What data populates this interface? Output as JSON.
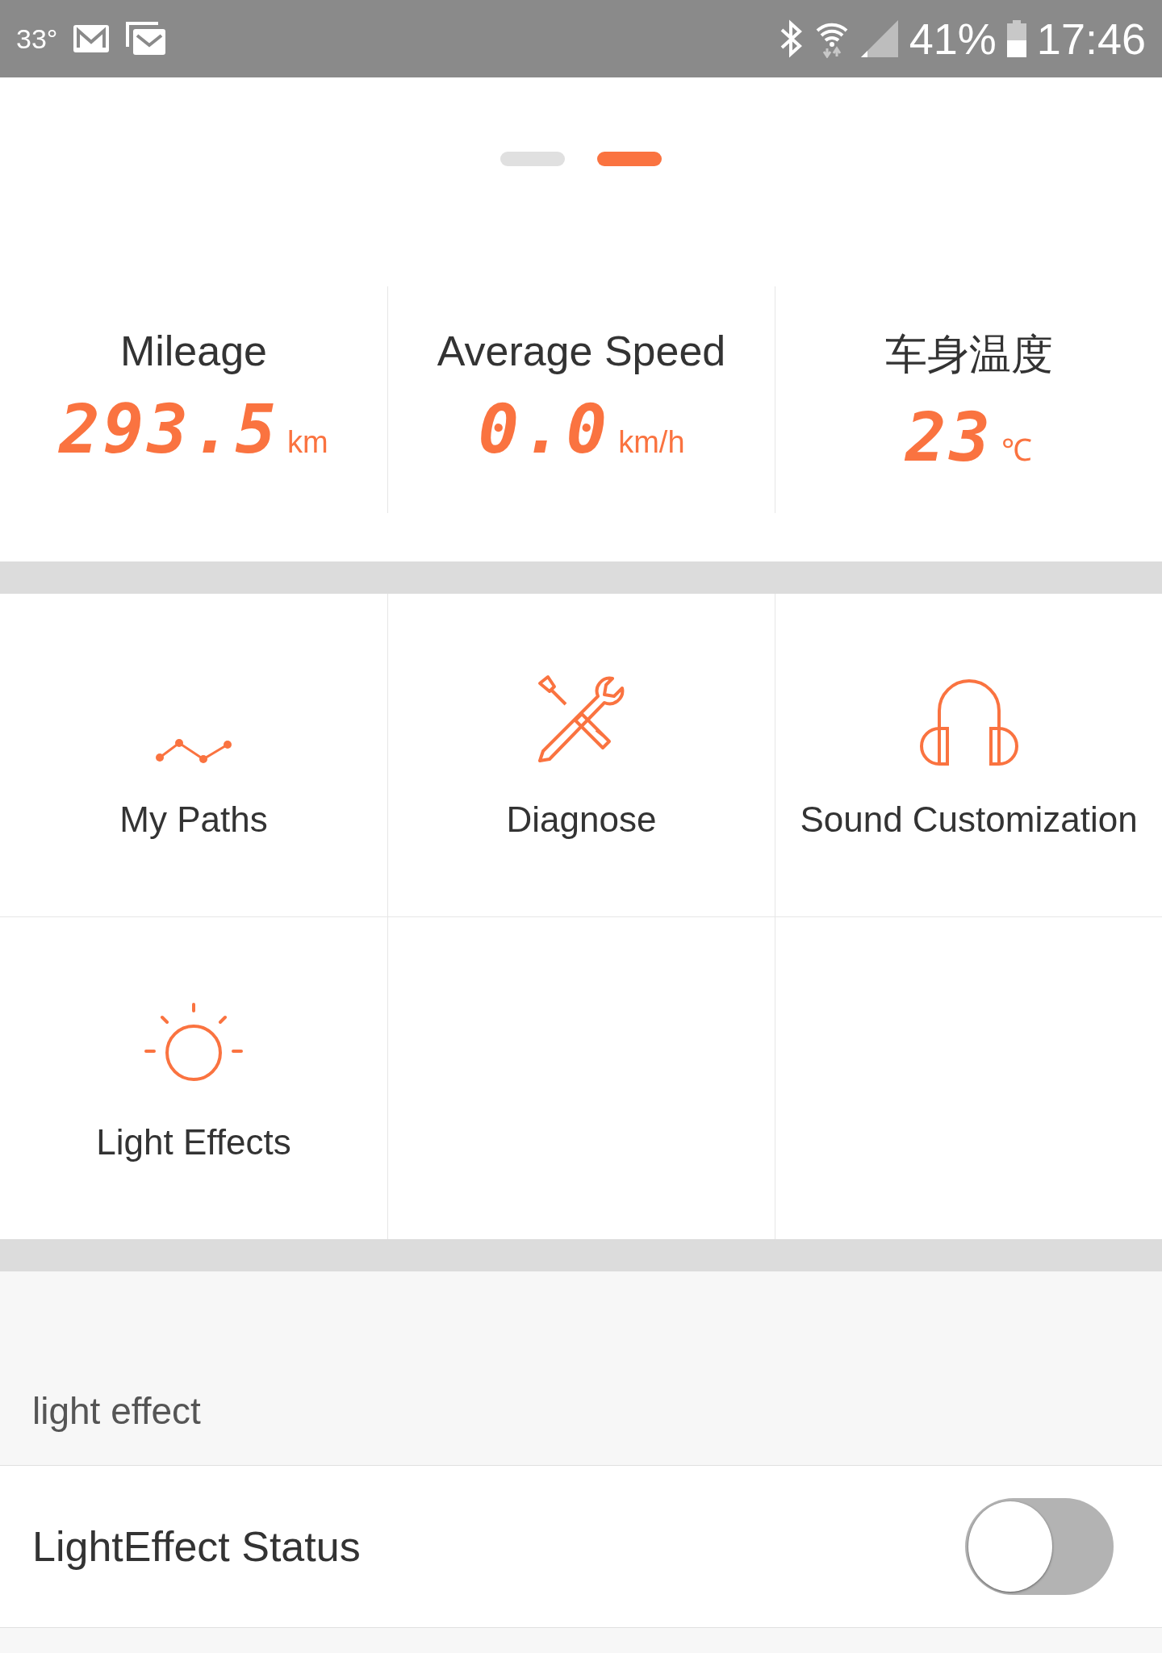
{
  "status_bar": {
    "temperature": "33°",
    "battery": "41%",
    "time": "17:46"
  },
  "pager": [
    {
      "selected": false
    },
    {
      "selected": true
    }
  ],
  "stats": [
    {
      "label": "Mileage",
      "value": "293.5",
      "unit": "km"
    },
    {
      "label": "Average Speed",
      "value": "0.0",
      "unit": "km/h"
    },
    {
      "label": "车身温度",
      "value": "23",
      "unit": "℃"
    }
  ],
  "tiles": [
    {
      "kind": "paths",
      "label": "My Paths"
    },
    {
      "kind": "diagnose",
      "label": "Diagnose"
    },
    {
      "kind": "sound",
      "label": "Sound Customization"
    },
    {
      "kind": "light",
      "label": "Light Effects"
    },
    {
      "kind": "empty"
    },
    {
      "kind": "empty"
    }
  ],
  "section": {
    "title": "light effect"
  },
  "settings": [
    {
      "label": "LightEffect Status",
      "on": false
    }
  ]
}
